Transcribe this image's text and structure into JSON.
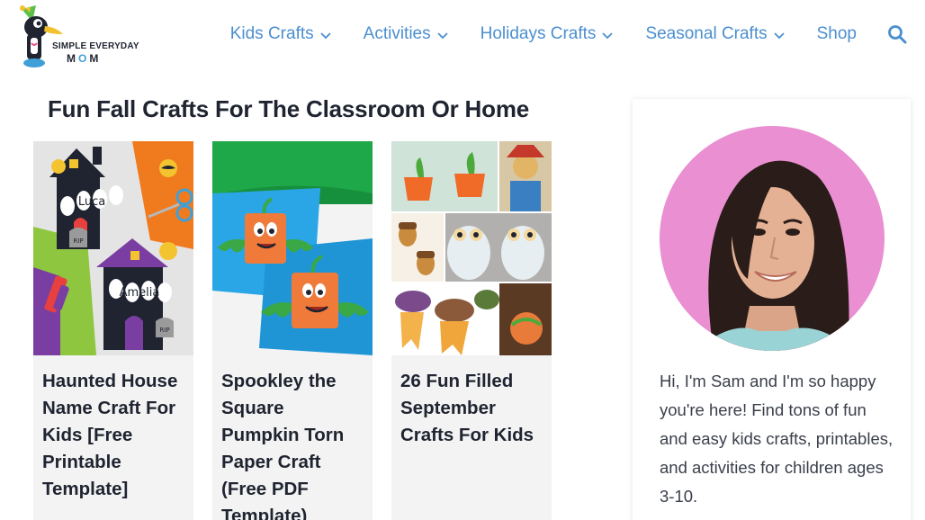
{
  "logo": {
    "line1": "SIMPLE EVERYDAY",
    "line2_m1": "M",
    "line2_o": "O",
    "line2_m2": "M"
  },
  "nav": {
    "items": [
      {
        "label": "Kids Crafts",
        "has_dropdown": true
      },
      {
        "label": "Activities",
        "has_dropdown": true
      },
      {
        "label": "Holidays Crafts",
        "has_dropdown": true
      },
      {
        "label": "Seasonal Crafts",
        "has_dropdown": true
      },
      {
        "label": "Shop",
        "has_dropdown": false
      }
    ],
    "search_icon": "search-icon"
  },
  "main": {
    "title": "Fun Fall Crafts For The Classroom Or Home",
    "cards": [
      {
        "title": "Haunted House Name Craft For Kids [Free Printable Template]",
        "image": "haunted-house-craft-image",
        "name_tag_1": "Luca",
        "name_tag_2": "Amelia",
        "rip_1": "RIP",
        "rip_2": "RIP"
      },
      {
        "title": "Spookley the Square Pumpkin Torn Paper Craft (Free PDF Template)",
        "image": "square-pumpkin-craft-image"
      },
      {
        "title": "26 Fun Filled September Crafts For Kids",
        "image": "september-crafts-collage-image"
      }
    ]
  },
  "sidebar": {
    "avatar": "author-photo",
    "bio": "Hi, I'm Sam and I'm so happy you're here! Find tons of fun and easy kids crafts, printables, and activities for children ages 3-10."
  },
  "colors": {
    "nav_link": "#4b8fcf",
    "heading": "#1f2430",
    "card_bg": "#f3f3f4",
    "avatar_bg": "#e98fd2"
  }
}
